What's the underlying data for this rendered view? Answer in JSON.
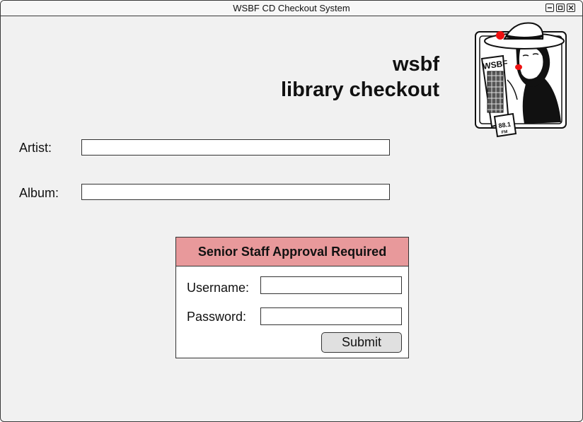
{
  "window": {
    "title": "WSBF CD Checkout System",
    "controls": [
      "minimize-icon",
      "maximize-icon",
      "close-icon"
    ]
  },
  "header": {
    "line1": "wsbf",
    "line2": "library checkout",
    "logo_icon": "wsbf-88.1-fm-lady-logo"
  },
  "form": {
    "artist_label": "Artist:",
    "artist_value": "",
    "album_label": "Album:",
    "album_value": ""
  },
  "approval": {
    "title": "Senior Staff Approval Required",
    "username_label": "Username:",
    "username_value": "",
    "password_label": "Password:",
    "password_value": "",
    "submit_label": "Submit",
    "header_color": "#e8999b"
  }
}
